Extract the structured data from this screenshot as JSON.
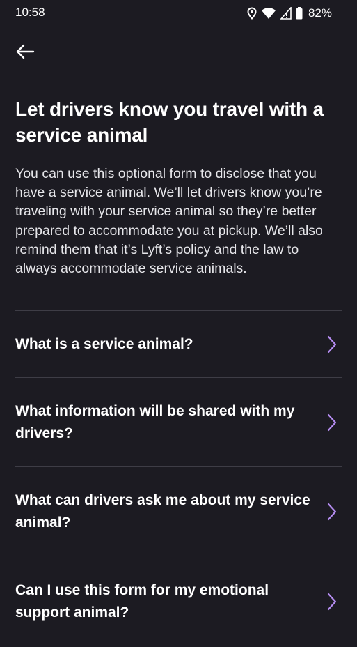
{
  "status_bar": {
    "time": "10:58",
    "battery_percent": "82%",
    "icons": [
      "location-icon",
      "wifi-icon",
      "signal-icon",
      "battery-icon"
    ]
  },
  "header": {
    "back_icon": "back-arrow-icon",
    "title": "Let drivers know you travel with a service animal"
  },
  "description": "You can use this optional form to disclose that you have a service animal. We’ll let drivers know you’re traveling with your service animal so they’re better prepared to accommodate you at pickup. We’ll also remind them that it’s Lyft’s policy and the law to always accommodate service animals.",
  "faq": [
    {
      "label": "What is a service animal?"
    },
    {
      "label": "What information will be shared with my drivers?"
    },
    {
      "label": "What can drivers ask me about my service animal?"
    },
    {
      "label": "Can I use this form for my emotional support animal?"
    }
  ],
  "colors": {
    "background": "#1c1b22",
    "accent_chevron": "#b48cf0",
    "divider": "#3e3d46"
  }
}
